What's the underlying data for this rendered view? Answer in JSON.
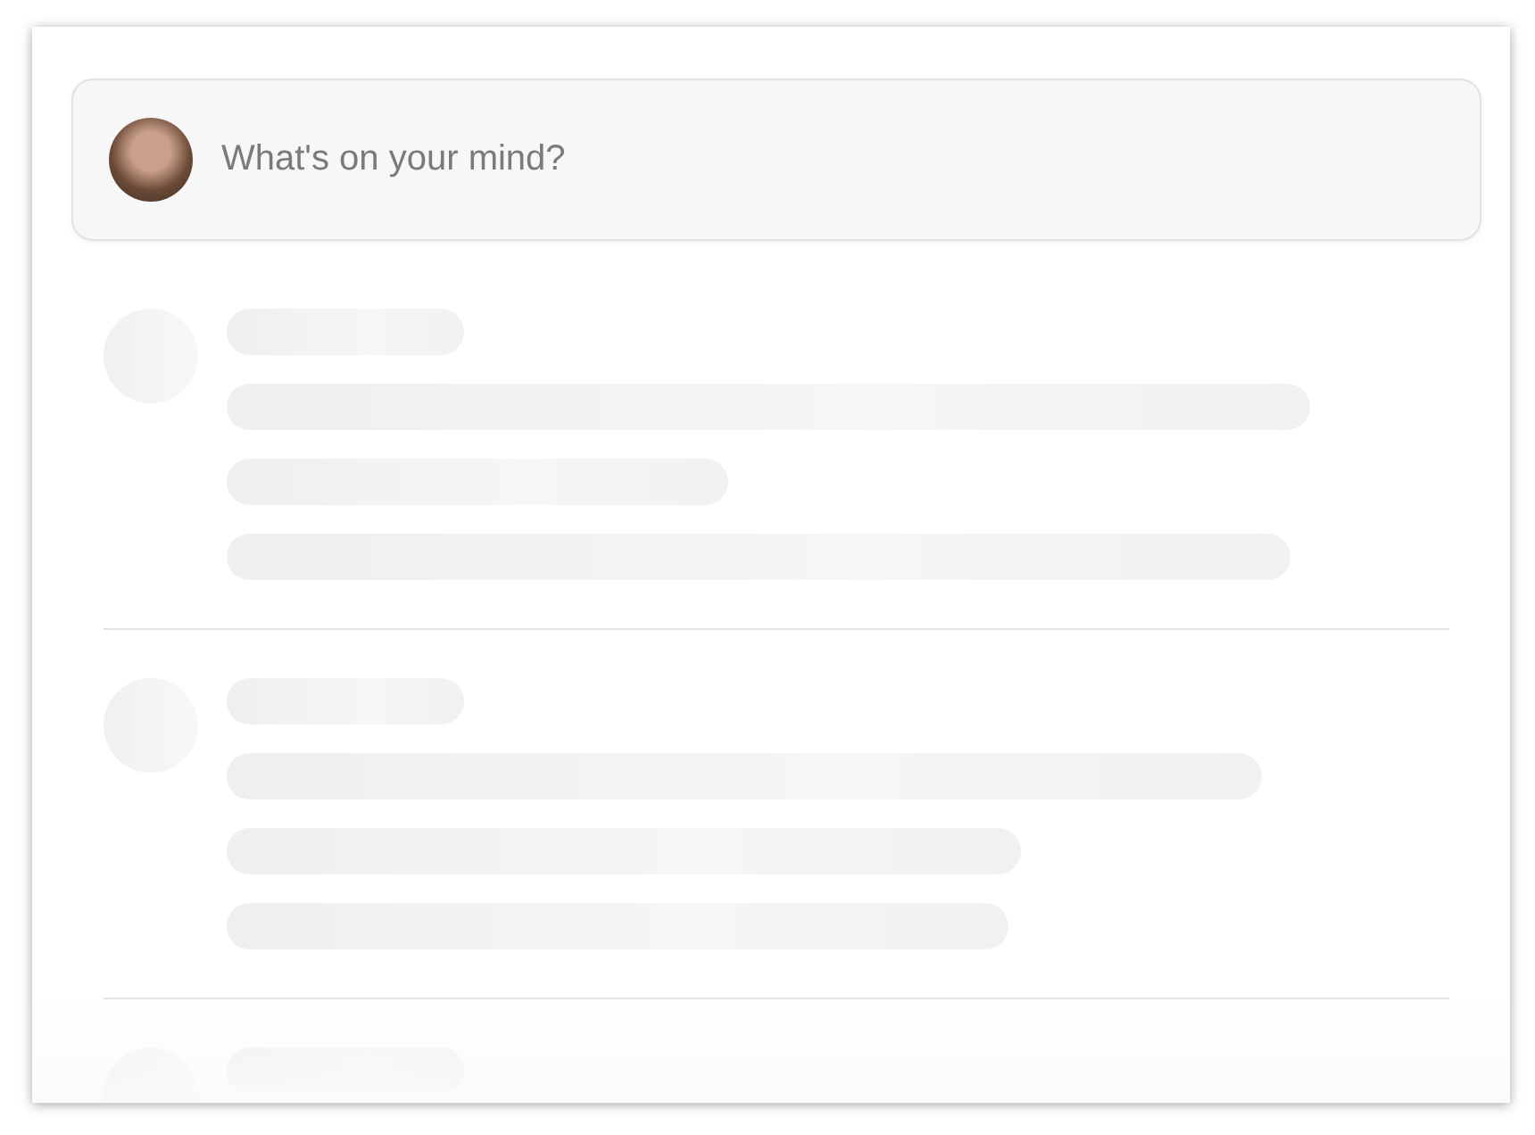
{
  "composer": {
    "placeholder": "What's on your mind?"
  },
  "feed": {
    "loading": true
  }
}
